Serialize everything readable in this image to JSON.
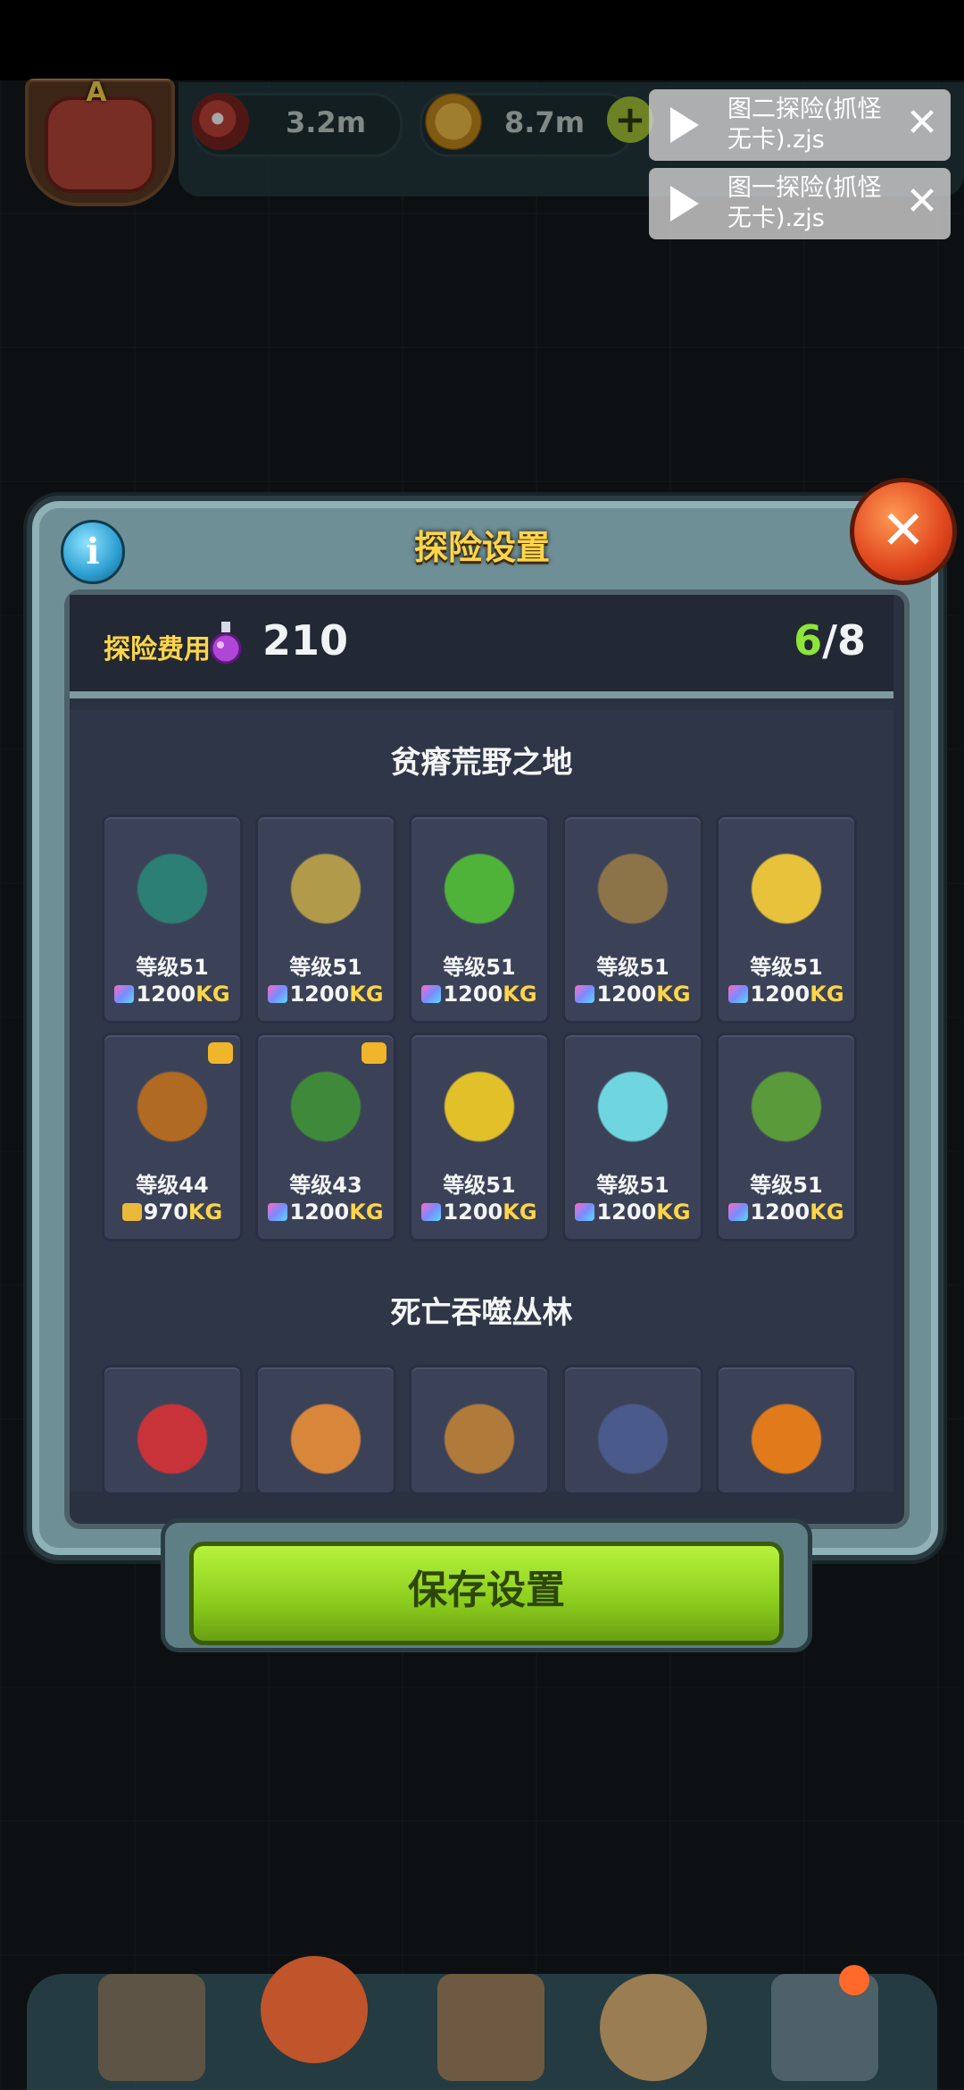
{
  "resources": [
    {
      "icon": "eyeball-icon",
      "value": "3.2m"
    },
    {
      "icon": "gold-coin-icon",
      "value": "8.7m"
    }
  ],
  "notifications": [
    {
      "text": "图二探险(抓怪无卡).zjs"
    },
    {
      "text": "图一探险(抓怪无卡).zjs"
    }
  ],
  "badge_letter": "A",
  "dialog": {
    "title": "探险设置",
    "close_symbol": "✕",
    "info_symbol": "i",
    "cost_label": "探险费用",
    "cost_value": "210",
    "slots_used": "6",
    "slots_rest": "/8",
    "regions": [
      {
        "name": "贫瘠荒野之地",
        "monsters": [
          {
            "icon": "twin-bird-monster-icon",
            "level": "等级51",
            "weight": "1200",
            "unit": "KG",
            "color": "#2b7f74"
          },
          {
            "icon": "wheat-monster-icon",
            "level": "等级51",
            "weight": "1200",
            "unit": "KG",
            "color": "#b19a4a"
          },
          {
            "icon": "lettuce-monster-icon",
            "level": "等级51",
            "weight": "1200",
            "unit": "KG",
            "color": "#4fb33a"
          },
          {
            "icon": "sack-monster-icon",
            "level": "等级51",
            "weight": "1200",
            "unit": "KG",
            "color": "#8c7448"
          },
          {
            "icon": "chick-egg-monster-icon",
            "level": "等级51",
            "weight": "1200",
            "unit": "KG",
            "color": "#e8c23a"
          },
          {
            "icon": "yak-monster-icon",
            "level": "等级44",
            "weight": "970",
            "unit": "KG",
            "color": "#b06a22",
            "gold_bag": true,
            "crown": true
          },
          {
            "icon": "tree-monster-icon",
            "level": "等级43",
            "weight": "1200",
            "unit": "KG",
            "color": "#3f8a3a",
            "crown": true
          },
          {
            "icon": "corn-monster-icon",
            "level": "等级51",
            "weight": "1200",
            "unit": "KG",
            "color": "#e2c02a"
          },
          {
            "icon": "ghost-monster-icon",
            "level": "等级51",
            "weight": "1200",
            "unit": "KG",
            "color": "#6fd6e0"
          },
          {
            "icon": "cactus-monster-icon",
            "level": "等级51",
            "weight": "1200",
            "unit": "KG",
            "color": "#5a9a3a"
          }
        ]
      },
      {
        "name": "死亡吞噬丛林",
        "monsters": [
          {
            "icon": "toad-monster-icon",
            "color": "#c8333a"
          },
          {
            "icon": "mushroom-cow-icon",
            "color": "#d8863a"
          },
          {
            "icon": "ape-monster-icon",
            "color": "#b07a3a"
          },
          {
            "icon": "chainsaw-cow-icon",
            "color": "#4a5a8a"
          },
          {
            "icon": "pumpkin-monster-icon",
            "color": "#e07a1a"
          }
        ]
      }
    ]
  },
  "save_button_label": "保存设置",
  "bottom_nav": [
    "shop-icon",
    "monster-icon",
    "book-icon",
    "bag-icon",
    "grid-icon"
  ]
}
